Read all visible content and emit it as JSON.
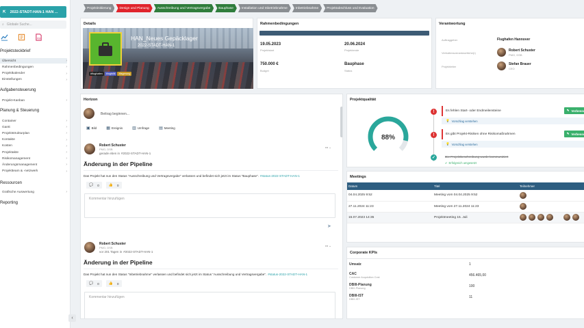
{
  "sidebar": {
    "project_button": "2022-STADT-HAN-1 HAN ...",
    "search_placeholder": "Globale Suche...",
    "sections": {
      "steckbrief": "Projektsteckbrief",
      "aufgaben": "Aufgabensteuerung",
      "planung": "Planung & Steuerung",
      "ressourcen": "Ressourcen",
      "reporting": "Reporting"
    },
    "steckbrief_items": [
      "Übersicht",
      "Rahmenbedingungen",
      "Projektkalender",
      "Einstellungen"
    ],
    "aufgaben_items": [
      "Projekt-Kanban"
    ],
    "planung_items": [
      "Container",
      "Gantt",
      "Projektstrukturplan",
      "Kontakte",
      "Kosten",
      "Projektakte",
      "Risikomanagement",
      "Änderungsmanagement",
      "Projektteam & -netzwerk"
    ],
    "ressourcen_items": [
      "Grafische Auswertung"
    ]
  },
  "phases": [
    {
      "label": "Projektinitiierung",
      "color": "#8a8e92"
    },
    {
      "label": "Design und Planung",
      "color": "#e0242c"
    },
    {
      "label": "Ausschreibung und Vertragsvergabe",
      "color": "#2f7d3c"
    },
    {
      "label": "Bauphase",
      "color": "#2f7d3c"
    },
    {
      "label": "Installation und Inbetriebnahme",
      "color": "#8a8e92"
    },
    {
      "label": "Inbetriebnahme",
      "color": "#8a8e92"
    },
    {
      "label": "Projektabschluss und Evaluation",
      "color": "#8a8e92"
    }
  ],
  "details": {
    "title": "Details",
    "project_name": "HAN_Neues Gepäcklager",
    "project_code": "2022-STADT-HAN-1",
    "tags": [
      {
        "label": "#flughafen",
        "color": "#222"
      },
      {
        "label": "#logistik",
        "color": "#5560c0"
      },
      {
        "label": "#lagerung",
        "color": "#c79a25"
      }
    ]
  },
  "rahmen": {
    "title": "Rahmenbedingungen",
    "start": "19.05.2023",
    "start_label": "Projektstart",
    "end": "20.06.2024",
    "end_label": "Projektende",
    "budget": "750.000 €",
    "budget_label": "Budget",
    "status": "Bauphase",
    "status_label": "Status"
  },
  "verantwortung": {
    "title": "Verantwortung",
    "rows": [
      {
        "label": "Auftraggeber",
        "name": "Flughafen Hannover",
        "sub": ""
      },
      {
        "label": "Verhaltensverantwortliche(r)",
        "name": "Robert Schuster",
        "sub": "PMO, DSB"
      },
      {
        "label": "Projektleiter",
        "name": "Stefan Brauer",
        "sub": "CEO"
      }
    ]
  },
  "horizon": {
    "title": "Horizon",
    "post_placeholder": "Beitrag beginnen...",
    "actions": [
      "Bild",
      "Ereignis",
      "Umfrage",
      "Meeting"
    ],
    "posts": [
      {
        "author": "Robert Schuster",
        "role": "PMO, DSB",
        "time": "gerade eben in",
        "tag": "#2022-STADT-HAN-1",
        "headline": "Änderung in der Pipeline",
        "body": "Das Projekt hat nun den Status \"Ausschreibung und Vertragsvergabe\" verlassen und befindet sich jetzt im Status \"Bauphase\".",
        "status_tag": "#status-2022-STADT-HAN-1",
        "comments": "0",
        "likes": "0",
        "comment_placeholder": "Kommentar hinzufügen"
      },
      {
        "author": "Robert Schuster",
        "role": "PMO, DSB",
        "time": "vor 201 Tagen in",
        "tag": "#2022-STADT-HAN-1",
        "headline": "Änderung in der Pipeline",
        "body": "Das Projekt hat nun den Status \"Inbetriebnahme\" verlassen und befindet sich jetzt im Status \"Ausschreibung und Vertragsvergabe\".",
        "status_tag": "#status-2022-STADT-HAN-1",
        "comments": "0",
        "likes": "0",
        "comment_placeholder": "Kommentar hinzufügen"
      }
    ]
  },
  "quality": {
    "title": "Projektqualität",
    "percent": 88,
    "percent_label": "88%",
    "issues": [
      {
        "text": "Es fehlen Start- oder Endmeilensteine",
        "hint": "Vorschlag verstehen",
        "button": "Verbesse"
      },
      {
        "text": "Es gibt Projekt-Risiken ohne Risikomaßnahmen",
        "hint": "Vorschlag verstehen",
        "button": "Verbesse"
      }
    ],
    "done": {
      "text": "Die Projektbeschreibung wurde kommuniziert",
      "sub": "Erfolgreich umgesetzt"
    },
    "colors": {
      "ring": "#2aa79b",
      "track": "#e3e7ea"
    }
  },
  "meetings": {
    "title": "Meetings",
    "headers": [
      "Datum",
      "Titel",
      "Teilnehmer"
    ],
    "rows": [
      {
        "date": "04.04.2025 9:52",
        "title": "Meeting vom 04.04.2025 9:52",
        "avatars": 1
      },
      {
        "date": "27.11.2024 11:23",
        "title": "Meeting vom 27.11.2024 11:23",
        "avatars": 1
      },
      {
        "date": "15.07.2023 14:35",
        "title": "Projektmeeting 15. Juli",
        "avatars": 6
      }
    ]
  },
  "kpis": {
    "title": "Corporate KPIs",
    "rows": [
      {
        "name": "Umsatz",
        "sub": "",
        "value": "1"
      },
      {
        "name": "CAC",
        "sub": "Customer Acquisition Cost",
        "value": "456.465,00"
      },
      {
        "name": "DBIII-Planung",
        "sub": "DBIII-Planung",
        "value": "100"
      },
      {
        "name": "DBIII-IST",
        "sub": "DBIII-IST",
        "value": "11"
      }
    ]
  }
}
